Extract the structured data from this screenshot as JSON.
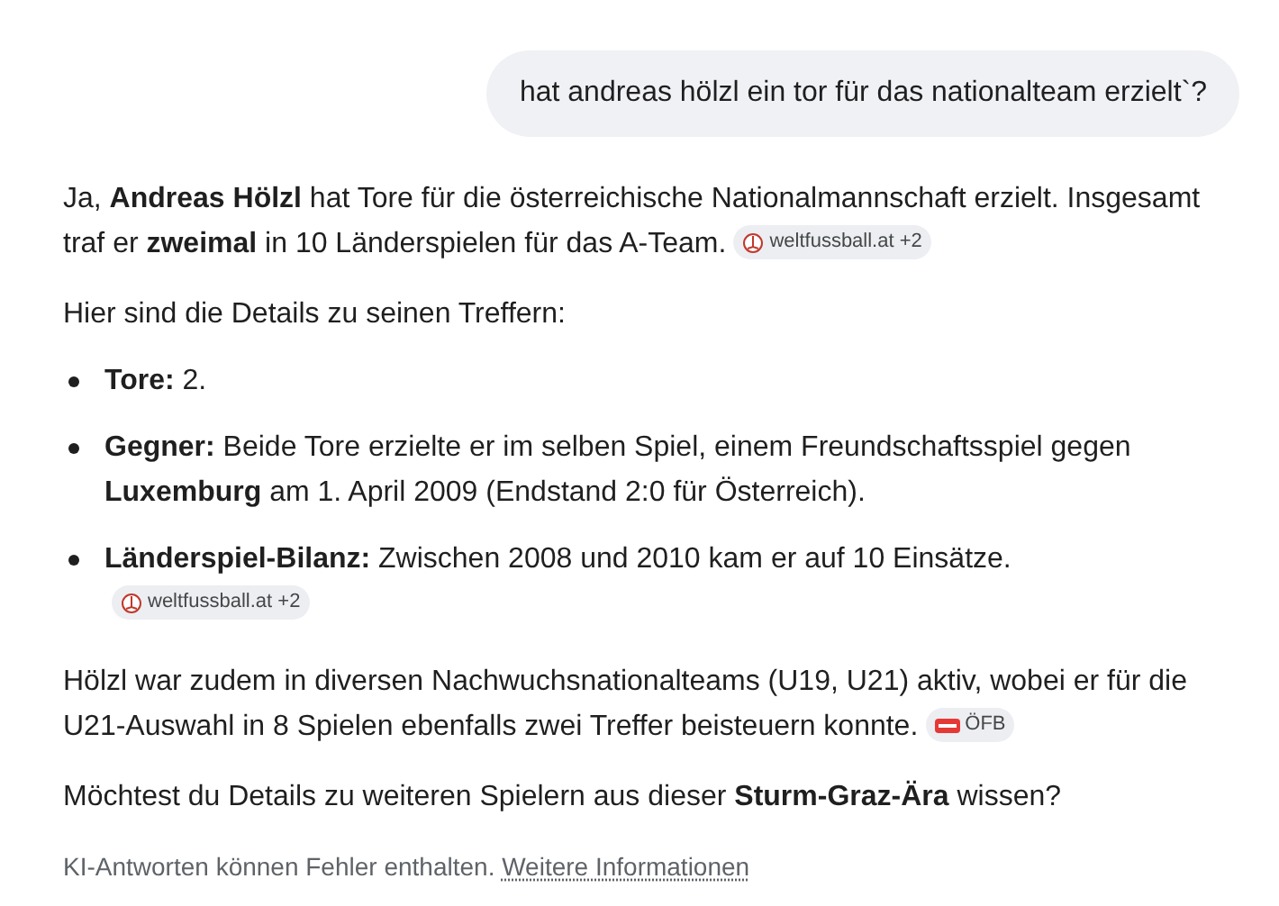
{
  "user_message": "hat andreas hölzl ein tor für das nationalteam erzielt`?",
  "answer": [
    {
      "kind": "paragraph",
      "text": "Ja, **Andreas Hölzl** hat Tore für die österreichische Nationalmannschaft erzielt. Insgesamt traf er **zweimal** in 10 Länderspielen für das A-Team.",
      "source": {
        "kind": "ball",
        "label": "weltfussball.at +2"
      }
    },
    {
      "kind": "paragraph",
      "text": "Hier sind die Details zu seinen Treffern:"
    },
    {
      "kind": "bullet",
      "text": "**Tore:** 2."
    },
    {
      "kind": "bullet",
      "text": "**Gegner:** Beide Tore erzielte er im selben Spiel, einem Freundschaftsspiel gegen **Luxemburg** am 1. April 2009 (Endstand 2:0 für Österreich)."
    },
    {
      "kind": "bullet",
      "text": "**Länderspiel-Bilanz:** Zwischen 2008 und 2010 kam er auf 10 Einsätze.",
      "source": {
        "kind": "ball",
        "label": "weltfussball.at +2"
      }
    },
    {
      "kind": "paragraph",
      "text": "Hölzl war zudem in diversen Nachwuchsnationalteams (U19, U21) aktiv, wobei er für die U21-Auswahl in 8 Spielen ebenfalls zwei Treffer beisteuern konnte.",
      "source": {
        "kind": "flag",
        "label": "ÖFB"
      }
    },
    {
      "kind": "paragraph",
      "text": "Möchtest du Details zu weiteren Spielern aus dieser **Sturm-Graz-Ära** wissen?"
    }
  ],
  "disclaimer": {
    "text": "KI-Antworten können Fehler enthalten.",
    "link": "Weitere Informationen"
  }
}
